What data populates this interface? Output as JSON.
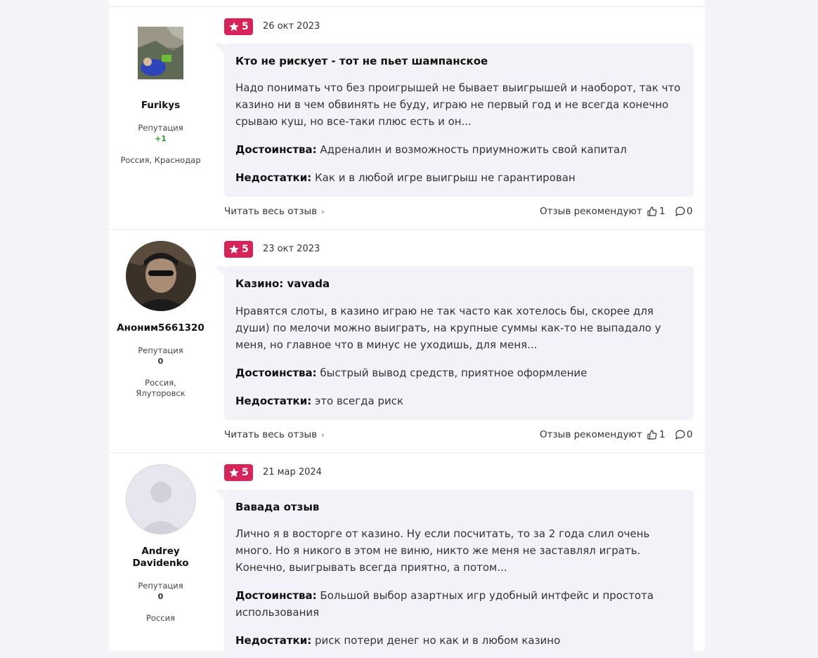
{
  "reviews": [
    {
      "author": {
        "name": "Furikys",
        "reputation_label": "Репутация",
        "reputation_value": "+1",
        "location": "Россия, Краснодар"
      },
      "rating": "5",
      "date": "26 окт 2023",
      "title": "Кто не рискует - тот не пьет шампанское",
      "text": "Надо понимать что без проигрышей не бывает выигрышей и наоборот, так что казино ни в чем обвинять не буду, играю не первый год и не всегда конечно срываю куш, но все-таки плюс есть и он...",
      "pros_label": "Достоинства:",
      "pros": "Адреналин и возможность приумножить свой капитал",
      "cons_label": "Недостатки:",
      "cons": "Как и в любой игре выигрыш не гарантирован",
      "read_more": "Читать весь отзыв",
      "recommend_label": "Отзыв рекомендуют",
      "likes": "1",
      "comments": "0"
    },
    {
      "author": {
        "name": "Аноним5661320",
        "reputation_label": "Репутация",
        "reputation_value": "0",
        "location_line1": "Россия,",
        "location_line2": "Ялуторовск"
      },
      "rating": "5",
      "date": "23 окт 2023",
      "title": "Казино: vavada",
      "text": "Нравятся слоты, в казино играю не так часто как хотелось бы, скорее для души) по мелочи можно выиграть, на крупные суммы как-то не выпадало у меня, но главное что в минус не уходишь, для меня...",
      "pros_label": "Достоинства:",
      "pros": "быстрый вывод средств, приятное оформление",
      "cons_label": "Недостатки:",
      "cons": "это всегда риск",
      "read_more": "Читать весь отзыв",
      "recommend_label": "Отзыв рекомендуют",
      "likes": "1",
      "comments": "0"
    },
    {
      "author": {
        "name_line1": "Andrey",
        "name_line2": "Davidenko",
        "reputation_label": "Репутация",
        "reputation_value": "0",
        "location": "Россия"
      },
      "rating": "5",
      "date": "21 мар 2024",
      "title": "Вавада отзыв",
      "text": "Лично я в восторге от казино. Ну если посчитать, то за 2 года слил очень много. Но я никого в этом не виню, никто же меня не заставлял играть. Конечно, выигрывать всегда приятно, а потом...",
      "pros_label": "Достоинства:",
      "pros": "Большой выбор азартных игр удобный интфейс и простота использования",
      "cons_label": "Недостатки:",
      "cons": "риск потери денег но как и в любом казино"
    }
  ],
  "colors": {
    "rating_badge": "#d6235a",
    "bubble_bg": "#f3f2f8",
    "positive_rep": "#2aa12a"
  },
  "icons": [
    "star-icon",
    "like-icon",
    "comment-icon",
    "chevron-right-icon"
  ]
}
